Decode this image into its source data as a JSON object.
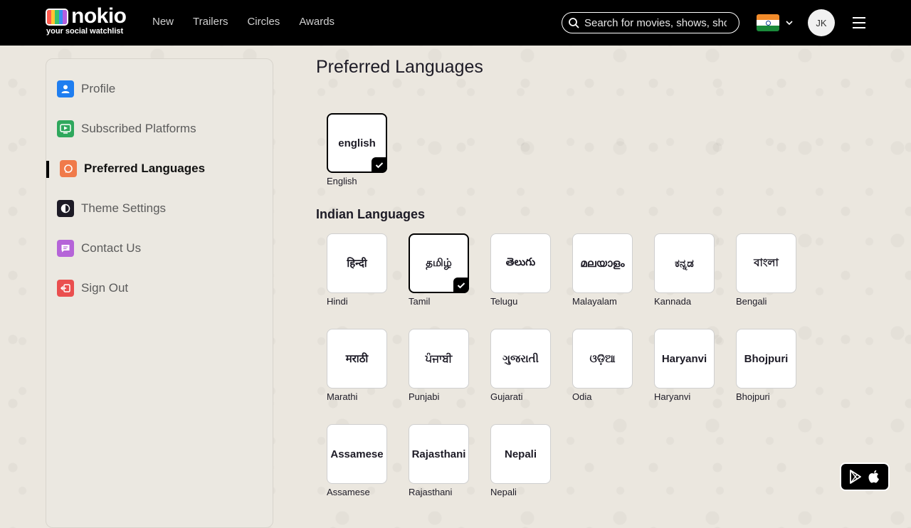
{
  "header": {
    "logo_word": "nokio",
    "logo_tagline": "your social watchlist",
    "nav": [
      "New",
      "Trailers",
      "Circles",
      "Awards"
    ],
    "search_placeholder": "Search for movies, shows, shows",
    "avatar_initials": "JK",
    "country_flag": "india-flag-icon"
  },
  "sidebar": {
    "items": [
      {
        "label": "Profile",
        "icon": "user-icon",
        "color": "#1f7ef0"
      },
      {
        "label": "Subscribed Platforms",
        "icon": "tv-play-icon",
        "color": "#2fa85d"
      },
      {
        "label": "Preferred Languages",
        "icon": "chat-icon",
        "color": "#f07a4a",
        "active": true
      },
      {
        "label": "Theme Settings",
        "icon": "theme-icon",
        "color": "#1d1b26"
      },
      {
        "label": "Contact Us",
        "icon": "message-icon",
        "color": "#b564d8"
      },
      {
        "label": "Sign Out",
        "icon": "sign-out-icon",
        "color": "#ea4f4f"
      }
    ]
  },
  "main": {
    "title": "Preferred Languages",
    "english": {
      "script": "english",
      "name": "English",
      "selected": true
    },
    "indian_title": "Indian Languages",
    "indian": [
      {
        "script": "हिन्दी",
        "name": "Hindi",
        "selected": false
      },
      {
        "script": "தமிழ்",
        "name": "Tamil",
        "selected": true
      },
      {
        "script": "తెలుగు",
        "name": "Telugu",
        "selected": false
      },
      {
        "script": "മലയാളം",
        "name": "Malayalam",
        "selected": false
      },
      {
        "script": "ಕನ್ನಡ",
        "name": "Kannada",
        "selected": false
      },
      {
        "script": "বাংলা",
        "name": "Bengali",
        "selected": false
      },
      {
        "script": "मराठी",
        "name": "Marathi",
        "selected": false
      },
      {
        "script": "ਪੰਜਾਬੀ",
        "name": "Punjabi",
        "selected": false
      },
      {
        "script": "ગુજરાતી",
        "name": "Gujarati",
        "selected": false
      },
      {
        "script": "ଓଡ଼ିଆ",
        "name": "Odia",
        "selected": false
      },
      {
        "script": "Haryanvi",
        "name": "Haryanvi",
        "selected": false
      },
      {
        "script": "Bhojpuri",
        "name": "Bhojpuri",
        "selected": false
      },
      {
        "script": "Assamese",
        "name": "Assamese",
        "selected": false
      },
      {
        "script": "Rajasthani",
        "name": "Rajasthani",
        "selected": false
      },
      {
        "script": "Nepali",
        "name": "Nepali",
        "selected": false
      }
    ]
  },
  "app_store_icons": [
    "google-play-icon",
    "apple-icon"
  ]
}
